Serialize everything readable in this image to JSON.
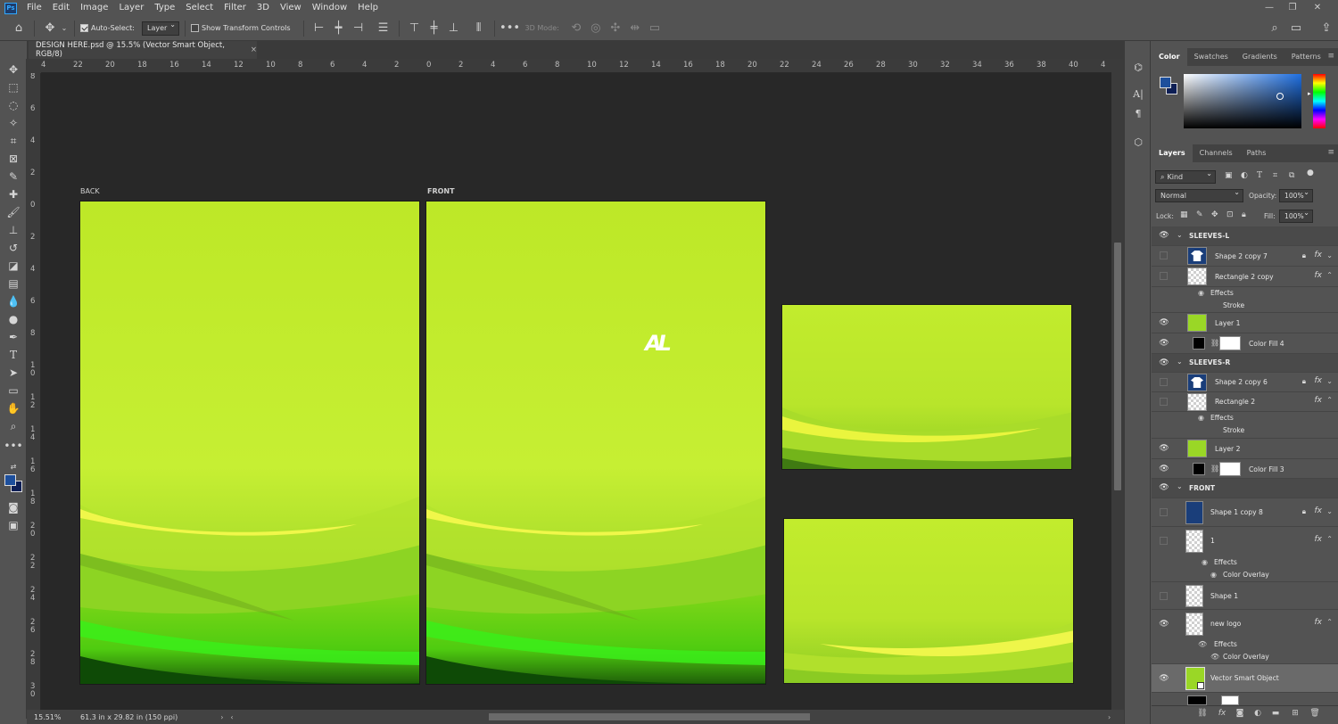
{
  "menu": {
    "items": [
      "File",
      "Edit",
      "Image",
      "Layer",
      "Type",
      "Select",
      "Filter",
      "3D",
      "View",
      "Window",
      "Help"
    ]
  },
  "options": {
    "auto_select_label": "Auto-Select:",
    "auto_select_value": "Layer",
    "transform_label": "Show Transform Controls",
    "mode_label": "3D Mode:"
  },
  "document": {
    "tab_title": "DESIGN HERE.psd @ 15.5% (Vector Smart Object, RGB/8)",
    "zoom": "15.51%",
    "doc_size": "61.3 in x 29.82 in (150 ppi)",
    "h_ruler": [
      "4",
      "22",
      "20",
      "18",
      "16",
      "14",
      "12",
      "10",
      "8",
      "6",
      "4",
      "2",
      "0",
      "2",
      "4",
      "6",
      "8",
      "10",
      "12",
      "14",
      "16",
      "18",
      "20",
      "22",
      "24",
      "26",
      "28",
      "30",
      "32",
      "34",
      "36",
      "38",
      "40",
      "4"
    ],
    "v_ruler": [
      "8",
      "6",
      "4",
      "2",
      "0",
      "2",
      "4",
      "6",
      "8",
      "1\n0",
      "1\n2",
      "1\n4",
      "1\n6",
      "1\n8",
      "2\n0",
      "2\n2",
      "2\n4",
      "2\n6",
      "2\n8",
      "3\n0"
    ]
  },
  "artboards": {
    "back_label": "BACK",
    "front_label": "FRONT",
    "logo_text": "AL"
  },
  "colors": {
    "lime_light": "#c4ef2a",
    "lime_dark": "#3a8a06",
    "accent_fg": "#1d4f9c",
    "accent_bg": "#0e1f55"
  },
  "color_panel": {
    "tabs": [
      "Color",
      "Swatches",
      "Gradients",
      "Patterns"
    ],
    "active_tab": "Color"
  },
  "layers_panel": {
    "tabs": [
      "Layers",
      "Channels",
      "Paths"
    ],
    "active_tab": "Layers",
    "filter_label": "Kind",
    "blend_mode": "Normal",
    "opacity_label": "Opacity:",
    "opacity_value": "100%",
    "lock_label": "Lock:",
    "fill_label": "Fill:",
    "fill_value": "100%",
    "rows": [
      {
        "name": "SLEEVES-L"
      },
      {
        "name": "Shape 2 copy 7"
      },
      {
        "name": "Rectangle 2 copy"
      },
      {
        "name": "Effects"
      },
      {
        "name": "Stroke"
      },
      {
        "name": "Layer 1"
      },
      {
        "name": "Color Fill 4"
      },
      {
        "name": "SLEEVES-R"
      },
      {
        "name": "Shape 2 copy 6"
      },
      {
        "name": "Rectangle 2"
      },
      {
        "name": "Effects"
      },
      {
        "name": "Stroke"
      },
      {
        "name": "Layer 2"
      },
      {
        "name": "Color Fill 3"
      },
      {
        "name": "FRONT"
      },
      {
        "name": "Shape 1 copy 8"
      },
      {
        "name": "1"
      },
      {
        "name": "Effects"
      },
      {
        "name": "Color Overlay"
      },
      {
        "name": "Shape 1"
      },
      {
        "name": "new logo"
      },
      {
        "name": "Effects"
      },
      {
        "name": "Color Overlay"
      },
      {
        "name": "Vector Smart Object"
      }
    ]
  }
}
